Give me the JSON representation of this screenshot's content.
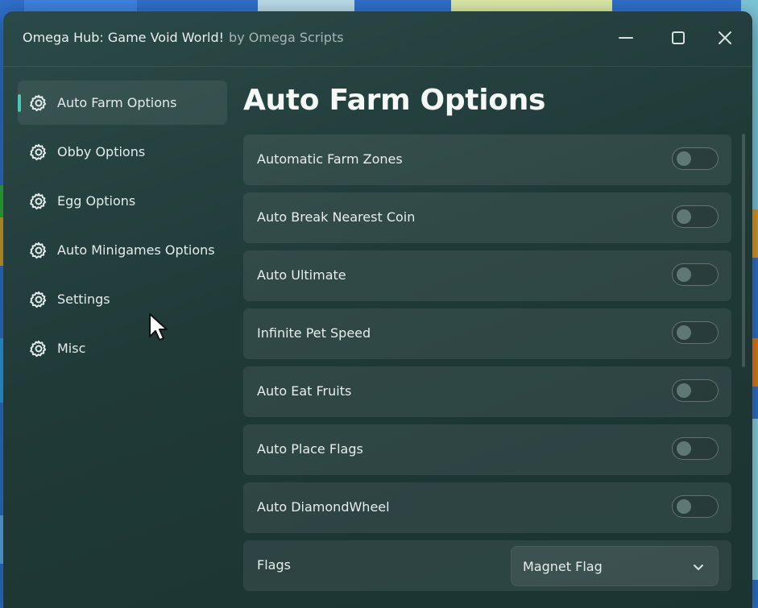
{
  "window": {
    "title": "Omega Hub: Game Void World!",
    "subtitle": "by Omega Scripts",
    "controls": [
      "minimize-icon",
      "maximize-icon",
      "close-icon"
    ]
  },
  "sidebar": {
    "items": [
      {
        "label": "Auto Farm Options",
        "icon": "gear-icon",
        "active": true
      },
      {
        "label": "Obby Options",
        "icon": "gear-icon",
        "active": false
      },
      {
        "label": "Egg Options",
        "icon": "gear-icon",
        "active": false
      },
      {
        "label": "Auto Minigames Options",
        "icon": "gear-icon",
        "active": false
      },
      {
        "label": "Settings",
        "icon": "gear-icon",
        "active": false
      },
      {
        "label": "Misc",
        "icon": "gear-icon",
        "active": false
      }
    ]
  },
  "main": {
    "heading": "Auto Farm Options",
    "toggles": [
      {
        "label": "Automatic Farm Zones",
        "on": false
      },
      {
        "label": "Auto Break Nearest Coin",
        "on": false
      },
      {
        "label": "Auto Ultimate",
        "on": false
      },
      {
        "label": "Infinite Pet Speed",
        "on": false
      },
      {
        "label": "Auto Eat Fruits",
        "on": false
      },
      {
        "label": "Auto Place Flags",
        "on": false
      },
      {
        "label": "Auto DiamondWheel",
        "on": false
      }
    ],
    "flags": {
      "label": "Flags",
      "selected": "Magnet Flag"
    }
  },
  "colors": {
    "accent": "#4ac7b5",
    "window_bg": "#203a38",
    "row_bg": "#2f4a48"
  }
}
